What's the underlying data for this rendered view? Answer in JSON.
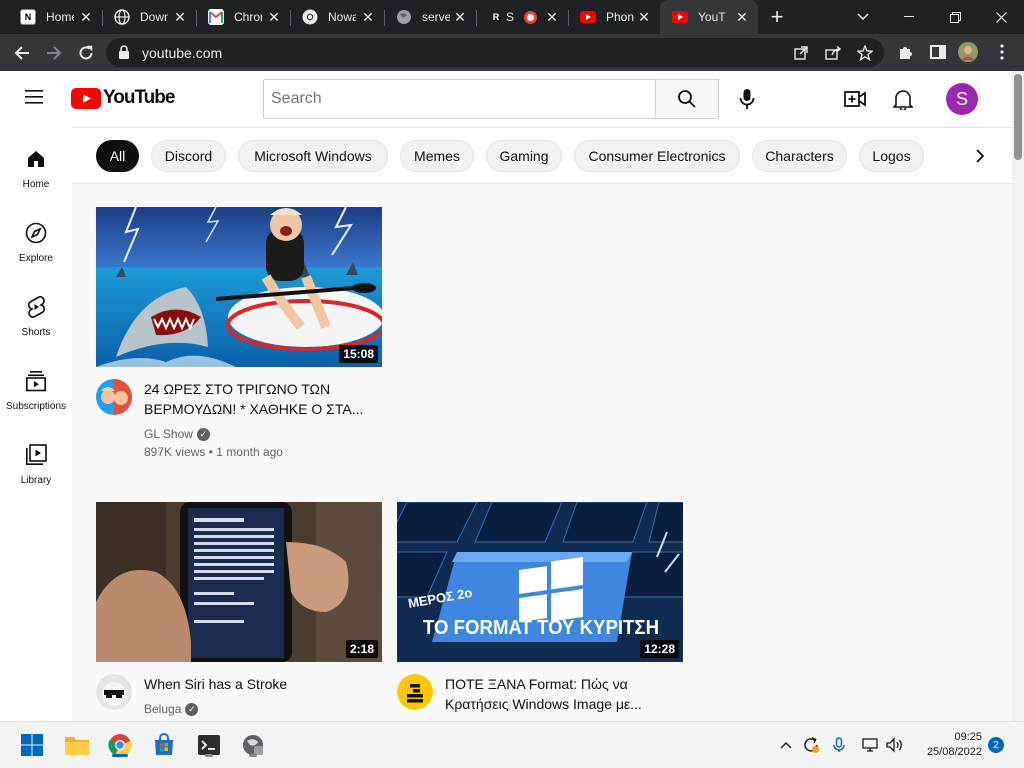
{
  "browser": {
    "tabs": [
      {
        "title": "Home",
        "favicon": "notion-icon",
        "active": false
      },
      {
        "title": "Down",
        "favicon": "globe-icon",
        "active": false
      },
      {
        "title": "Chron",
        "favicon": "gmail-icon",
        "active": false
      },
      {
        "title": "Nowa",
        "favicon": "chrome-icon",
        "active": false
      },
      {
        "title": "serve",
        "favicon": "globe-icon",
        "active": false
      },
      {
        "title": "S",
        "favicon": "r-icon",
        "active": false
      },
      {
        "title": "Phon",
        "favicon": "youtube-icon",
        "active": false
      },
      {
        "title": "YouT",
        "favicon": "youtube-icon",
        "active": true
      }
    ],
    "url": "youtube.com"
  },
  "youtube": {
    "logo_text": "YouTube",
    "search_placeholder": "Search",
    "avatar_letter": "S",
    "guide": [
      {
        "label": "Home",
        "icon": "home-icon"
      },
      {
        "label": "Explore",
        "icon": "compass-icon"
      },
      {
        "label": "Shorts",
        "icon": "shorts-icon"
      },
      {
        "label": "Subscriptions",
        "icon": "subscriptions-icon"
      },
      {
        "label": "Library",
        "icon": "library-icon"
      }
    ],
    "chips": [
      "All",
      "Discord",
      "Microsoft Windows",
      "Memes",
      "Gaming",
      "Consumer Electronics",
      "Characters",
      "Logos"
    ],
    "videos": [
      {
        "title": "24 ΩΡΕΣ ΣΤΟ ΤΡΙΓΩΝΟ ΤΩΝ ΒΕΡΜΟΥΔΩΝ! * ΧΑΘΗΚΕ Ο ΣΤΑ...",
        "channel": "GL Show",
        "views": "897K views",
        "age": "1 month ago",
        "duration": "15:08"
      },
      {
        "title": "When Siri has a Stroke",
        "channel": "Beluga",
        "duration": "2:18"
      },
      {
        "title": "ΠΟΤΕ ΞΑΝΑ Format: Πώς να Κρατήσεις Windows Image με...",
        "duration": "12:28",
        "thumb_text_1": "ΜΕΡΟΣ 2ο",
        "thumb_text_2": "TO FORMAT ΤΟΥ ΚΥΡΙΤΣΗ"
      }
    ]
  },
  "taskbar": {
    "time": "09:25",
    "date": "25/08/2022",
    "notifications": "2"
  },
  "colors": {
    "youtube_red": "#ff0000",
    "avatar_purple": "#9c27b0",
    "windows_blue": "#0067c0"
  }
}
